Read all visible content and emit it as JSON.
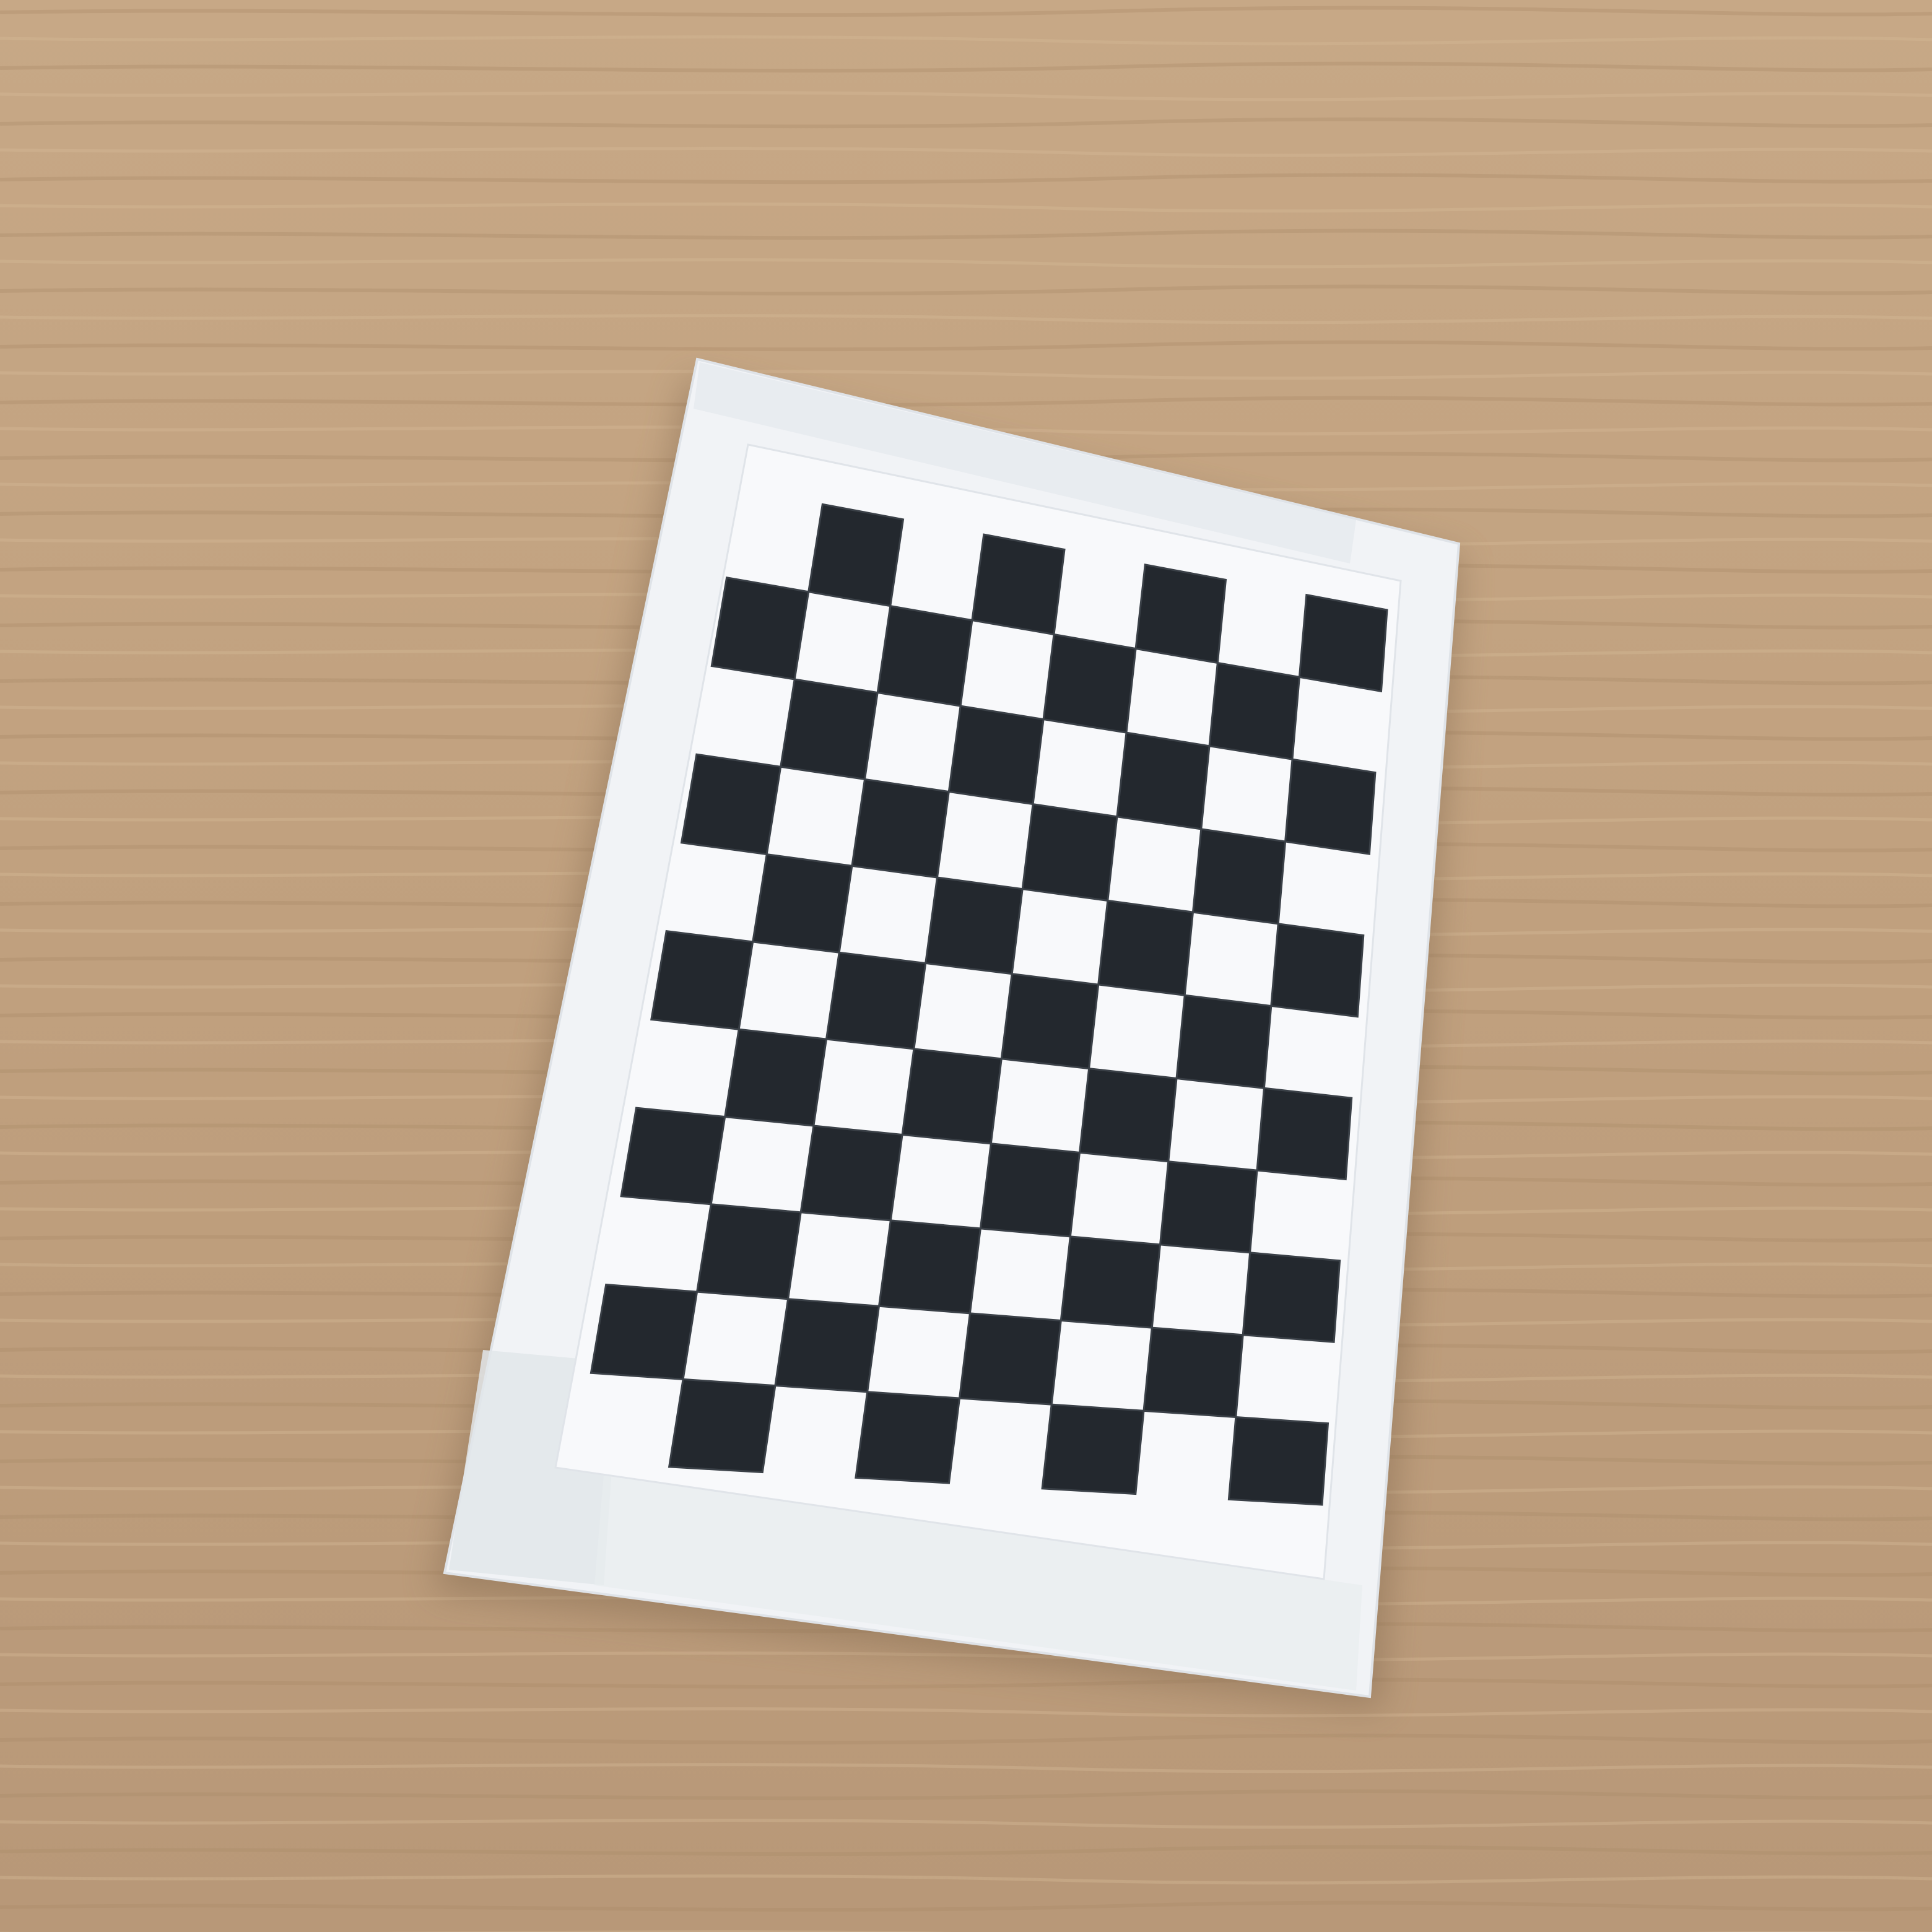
{
  "scene": {
    "description_kind": "photo",
    "board": {
      "rows": 11,
      "cols": 8,
      "first_cell_dark": false
    },
    "colors": {
      "table_light": "#c9ab88",
      "table_mid": "#b99a77",
      "table_dark": "#a8896a",
      "cardboard": "#f2f4f6",
      "paper": "#f7f8fa",
      "tape": "#e4e8ec",
      "dark_square": "#23282e",
      "dark_square_highlight": "#3a4047",
      "shadow": "#7e654c"
    }
  }
}
